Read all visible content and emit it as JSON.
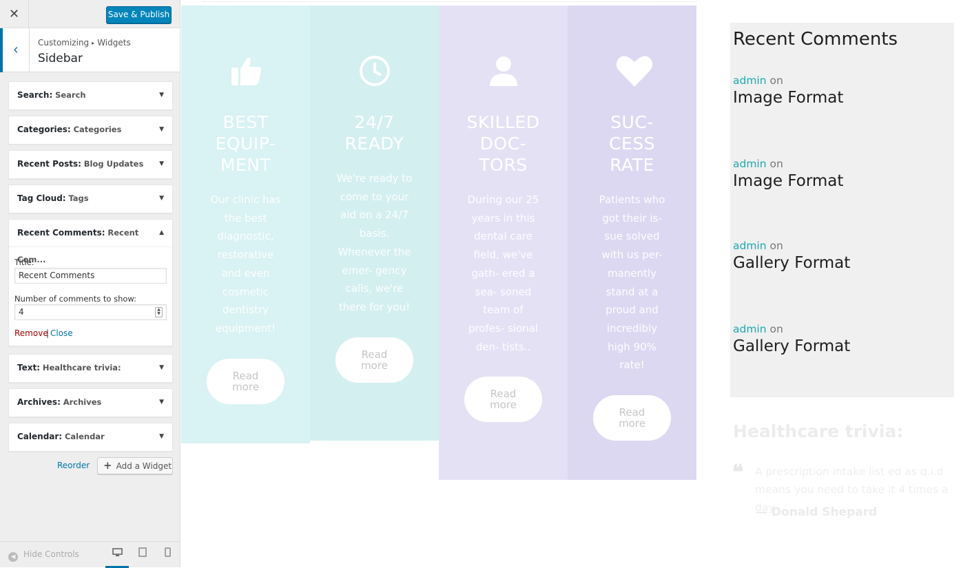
{
  "topbar": {
    "close_glyph": "✕",
    "save_label": "Save & Publish"
  },
  "section": {
    "back_glyph": "‹",
    "breadcrumb_root": "Customizing",
    "breadcrumb_sep": "▸",
    "breadcrumb_current": "Widgets",
    "title": "Sidebar"
  },
  "widgets": [
    {
      "type": "Search:",
      "title": "Search"
    },
    {
      "type": "Categories:",
      "title": "Categories"
    },
    {
      "type": "Recent Posts:",
      "title": "Blog Updates"
    },
    {
      "type": "Tag Cloud:",
      "title": "Tags"
    },
    {
      "type": "Recent Comments:",
      "title": "Recent Com..."
    },
    {
      "type": "Text:",
      "title": "Healthcare trivia:"
    },
    {
      "type": "Archives:",
      "title": "Archives"
    },
    {
      "type": "Calendar:",
      "title": "Calendar"
    }
  ],
  "arrows": {
    "down": "▼",
    "up": "▲"
  },
  "expanded_form": {
    "title_label": "Title:",
    "title_value": "Recent Comments",
    "count_label": "Number of comments to show:",
    "count_value": "4",
    "remove_label": "Remove",
    "pipe": "|",
    "close_label": "Close"
  },
  "actions": {
    "reorder_label": "Reorder",
    "add_widget_label": "Add a Widget",
    "add_glyph": "+"
  },
  "footer": {
    "hide_controls_label": "Hide Controls",
    "hide_glyph": "◀",
    "devices": [
      "desktop-icon",
      "tablet-icon",
      "mobile-icon"
    ]
  },
  "features": [
    {
      "icon": "thumbs-up-icon",
      "title": [
        "BEST",
        "EQUIP-",
        "MENT"
      ],
      "text": "Our clinic has the best diagnostic, restorative and even cosmetic dentistry equipment!",
      "button": [
        "Read",
        "more"
      ]
    },
    {
      "icon": "clock-icon",
      "title": [
        "24/7",
        "READY"
      ],
      "text": "We're ready to come to your aid on a 24/7 basis. Whenever the emer- gency calls, we're there for you!",
      "button": [
        "Read",
        "more"
      ]
    },
    {
      "icon": "user-icon",
      "title": [
        "SKILLED",
        "DOC-",
        "TORS"
      ],
      "text": "During our 25 years in this dental care field, we've gath- ered a sea- soned team of profes- sional den- tists..",
      "button": [
        "Read",
        "more"
      ]
    },
    {
      "icon": "heart-icon",
      "title": [
        "SUC-",
        "CESS",
        "RATE"
      ],
      "text": "Patients who got their is- sue solved with us per- manently stand at a proud and incredibly high 90% rate!",
      "button": [
        "Read",
        "more"
      ]
    }
  ],
  "recent_comments": {
    "title": "Recent Comments",
    "items": [
      {
        "author": "admin",
        "on": "on",
        "post": "Image Format"
      },
      {
        "author": "admin",
        "on": "on",
        "post": "Image Format"
      },
      {
        "author": "admin",
        "on": "on",
        "post": "Gallery Format"
      },
      {
        "author": "admin",
        "on": "on",
        "post": "Gallery Format"
      }
    ]
  },
  "trivia": {
    "title": "Healthcare trivia:",
    "quote_glyph": "❝",
    "quote": "A prescription intake list ed as q.i.d means you need to take it 4 times a day.",
    "author": "— Donald Shepard"
  },
  "colors": {
    "primary_button": "#0085ba",
    "link": "#0073aa",
    "remove": "#aa0000",
    "comment_author": "#1fa7b0",
    "teal_column": "#d9f2f3",
    "purple_column": "#e4e1f5"
  }
}
